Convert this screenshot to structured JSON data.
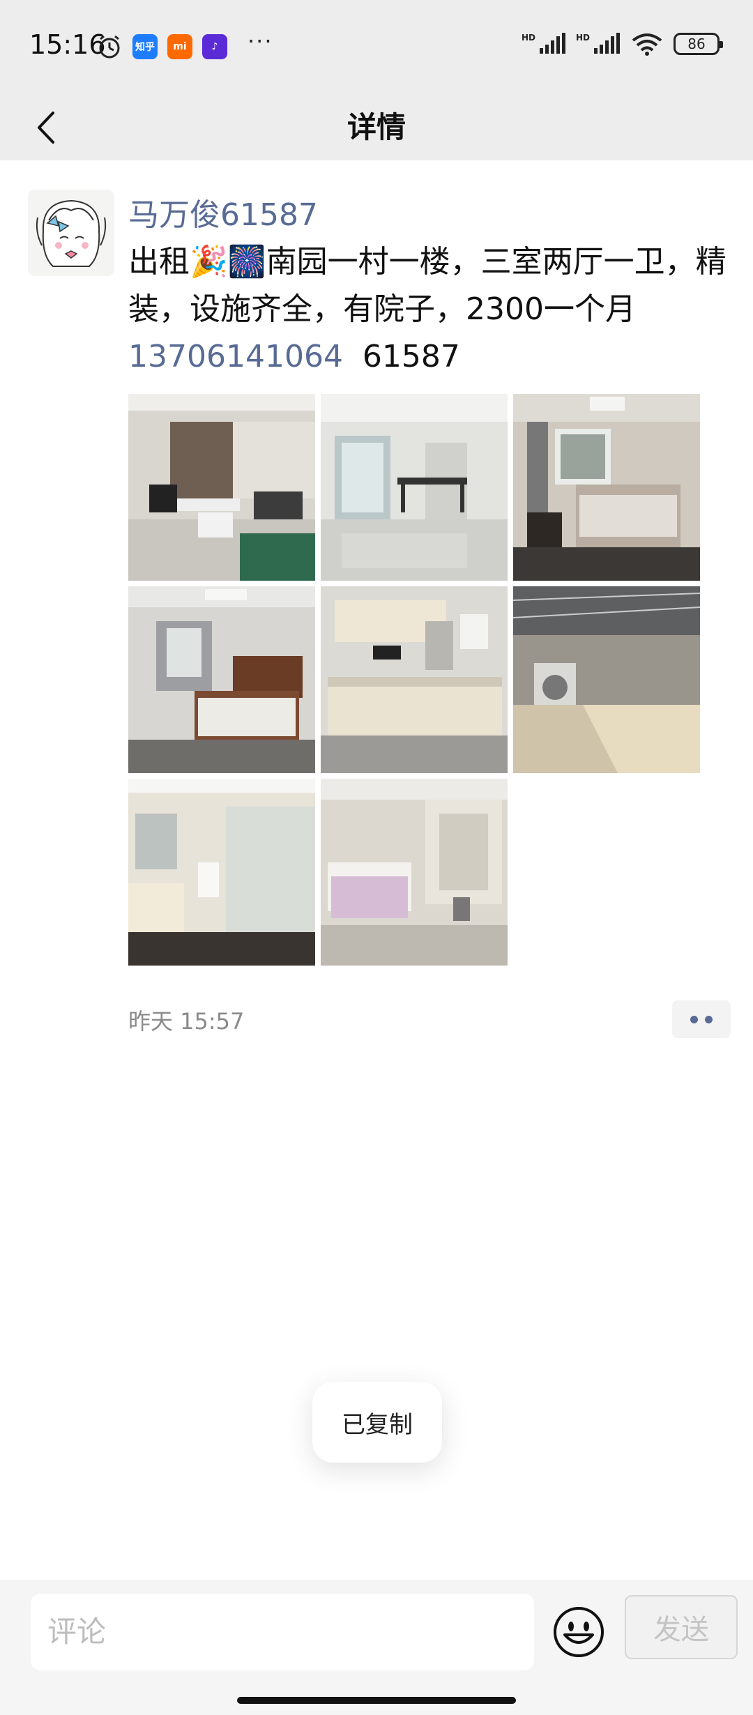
{
  "status_bar": {
    "time": "15:16",
    "app_icons": [
      {
        "name": "zhihu-icon",
        "label": "知乎",
        "color": "#1e7dff"
      },
      {
        "name": "mi-icon",
        "label": "mi",
        "color": "#ff6a00"
      },
      {
        "name": "douyin-icon",
        "label": "♪",
        "color": "#5b2bd8"
      }
    ],
    "more": "···",
    "hd1": "HD",
    "hd2": "HD",
    "battery": "86"
  },
  "nav": {
    "title": "详情",
    "back_icon": "chevron-left-icon"
  },
  "post": {
    "username": "马万俊61587",
    "text_before_emoji": "出租",
    "emojis": "🎉🎆",
    "text_after_emoji": "南园一村一楼，三室两厅一卫，精装，设施齐全，有院子，2300一个月",
    "phone": "13706141064",
    "code": "61587",
    "timestamp": "昨天 15:57",
    "photos": [
      {
        "name": "photo-living-room",
        "scene": "living room"
      },
      {
        "name": "photo-dining-room",
        "scene": "dining room"
      },
      {
        "name": "photo-bedroom-1",
        "scene": "bedroom"
      },
      {
        "name": "photo-bedroom-2",
        "scene": "bedroom"
      },
      {
        "name": "photo-kitchen",
        "scene": "kitchen"
      },
      {
        "name": "photo-sunroom",
        "scene": "sunroom"
      },
      {
        "name": "photo-bathroom",
        "scene": "bathroom"
      },
      {
        "name": "photo-bedroom-3",
        "scene": "small bedroom"
      }
    ]
  },
  "toast": {
    "text": "已复制"
  },
  "input_bar": {
    "placeholder": "评论",
    "send_label": "发送"
  }
}
